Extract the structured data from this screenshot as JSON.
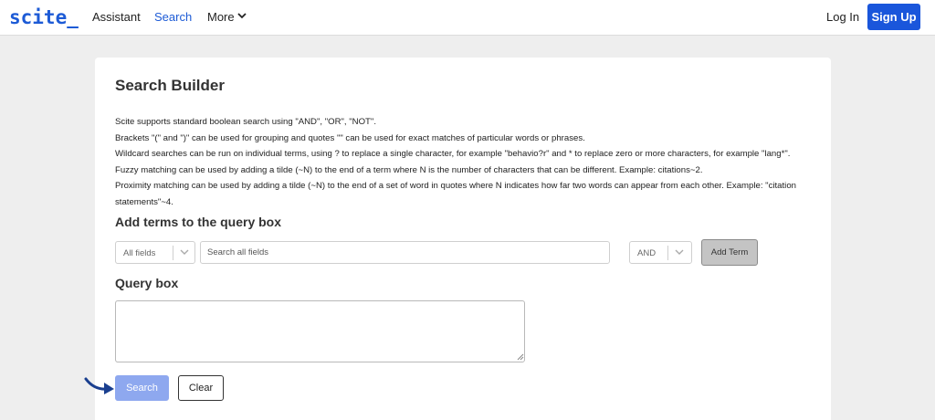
{
  "header": {
    "logo": "scite_",
    "nav": {
      "assistant": "Assistant",
      "search": "Search",
      "more": "More"
    },
    "login": "Log In",
    "signup": "Sign Up",
    "accent_color": "#1d5bd6"
  },
  "builder": {
    "title": "Search Builder",
    "help_lines": [
      "Scite supports standard boolean search using \"AND\", \"OR\", \"NOT\".",
      "Brackets \"(\" and \")\" can be used for grouping and quotes \"\" can be used for exact matches of particular words or phrases.",
      "Wildcard searches can be run on individual terms, using ? to replace a single character, for example \"behavio?r\" and * to replace zero or more characters, for example \"lang*\".",
      "Fuzzy matching can be used by adding a tilde (~N) to the end of a term where N is the number of characters that can be different. Example: citations~2.",
      "Proximity matching can be used by adding a tilde (~N) to the end of a set of word in quotes where N indicates how far two words can appear from each other. Example: \"citation statements\"~4."
    ],
    "terms_heading": "Add terms to the query box",
    "field_select": "All fields",
    "term_placeholder": "Search all fields",
    "operator_select": "AND",
    "add_term_label": "Add Term",
    "query_heading": "Query box",
    "query_value": "",
    "search_label": "Search",
    "clear_label": "Clear"
  }
}
